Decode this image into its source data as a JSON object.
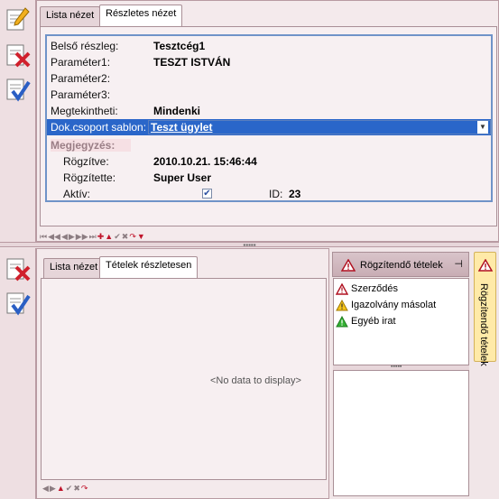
{
  "top": {
    "tabs": [
      "Lista nézet",
      "Részletes nézet"
    ],
    "fields": [
      {
        "label": "Belső részleg:",
        "value": "Tesztcég1"
      },
      {
        "label": "Paraméter1:",
        "value": "TESZT ISTVÁN"
      },
      {
        "label": "Paraméter2:",
        "value": ""
      },
      {
        "label": "Paraméter3:",
        "value": ""
      },
      {
        "label": "Megtekintheti:",
        "value": "Mindenki"
      }
    ],
    "template": {
      "label": "Dok.csoport sablon:",
      "value": "Teszt ügylet"
    },
    "note_label": "Megjegyzés:",
    "recorded_label": "Rögzítve:",
    "recorded_value": "2010.10.21. 15:46:44",
    "recorded_by_label": "Rögzítette:",
    "recorded_by_value": "Super User",
    "active_label": "Aktív:",
    "active_checked": true,
    "id_label": "ID:",
    "id_value": "23"
  },
  "bottom": {
    "tabs": [
      "Lista nézet",
      "Tételek részletesen"
    ],
    "empty_text": "<No data to display>"
  },
  "side": {
    "title": "Rögzítendő tételek",
    "items": [
      {
        "label": "Szerződés",
        "icon": "warning-red-icon",
        "color": "#c0142b"
      },
      {
        "label": "Igazolvány másolat",
        "icon": "warning-yellow-icon",
        "color": "#e6b200"
      },
      {
        "label": "Egyéb irat",
        "icon": "triangle-green-icon",
        "color": "#2f9a2f"
      }
    ],
    "vertical_tab": "Rögzítendő tételek"
  }
}
